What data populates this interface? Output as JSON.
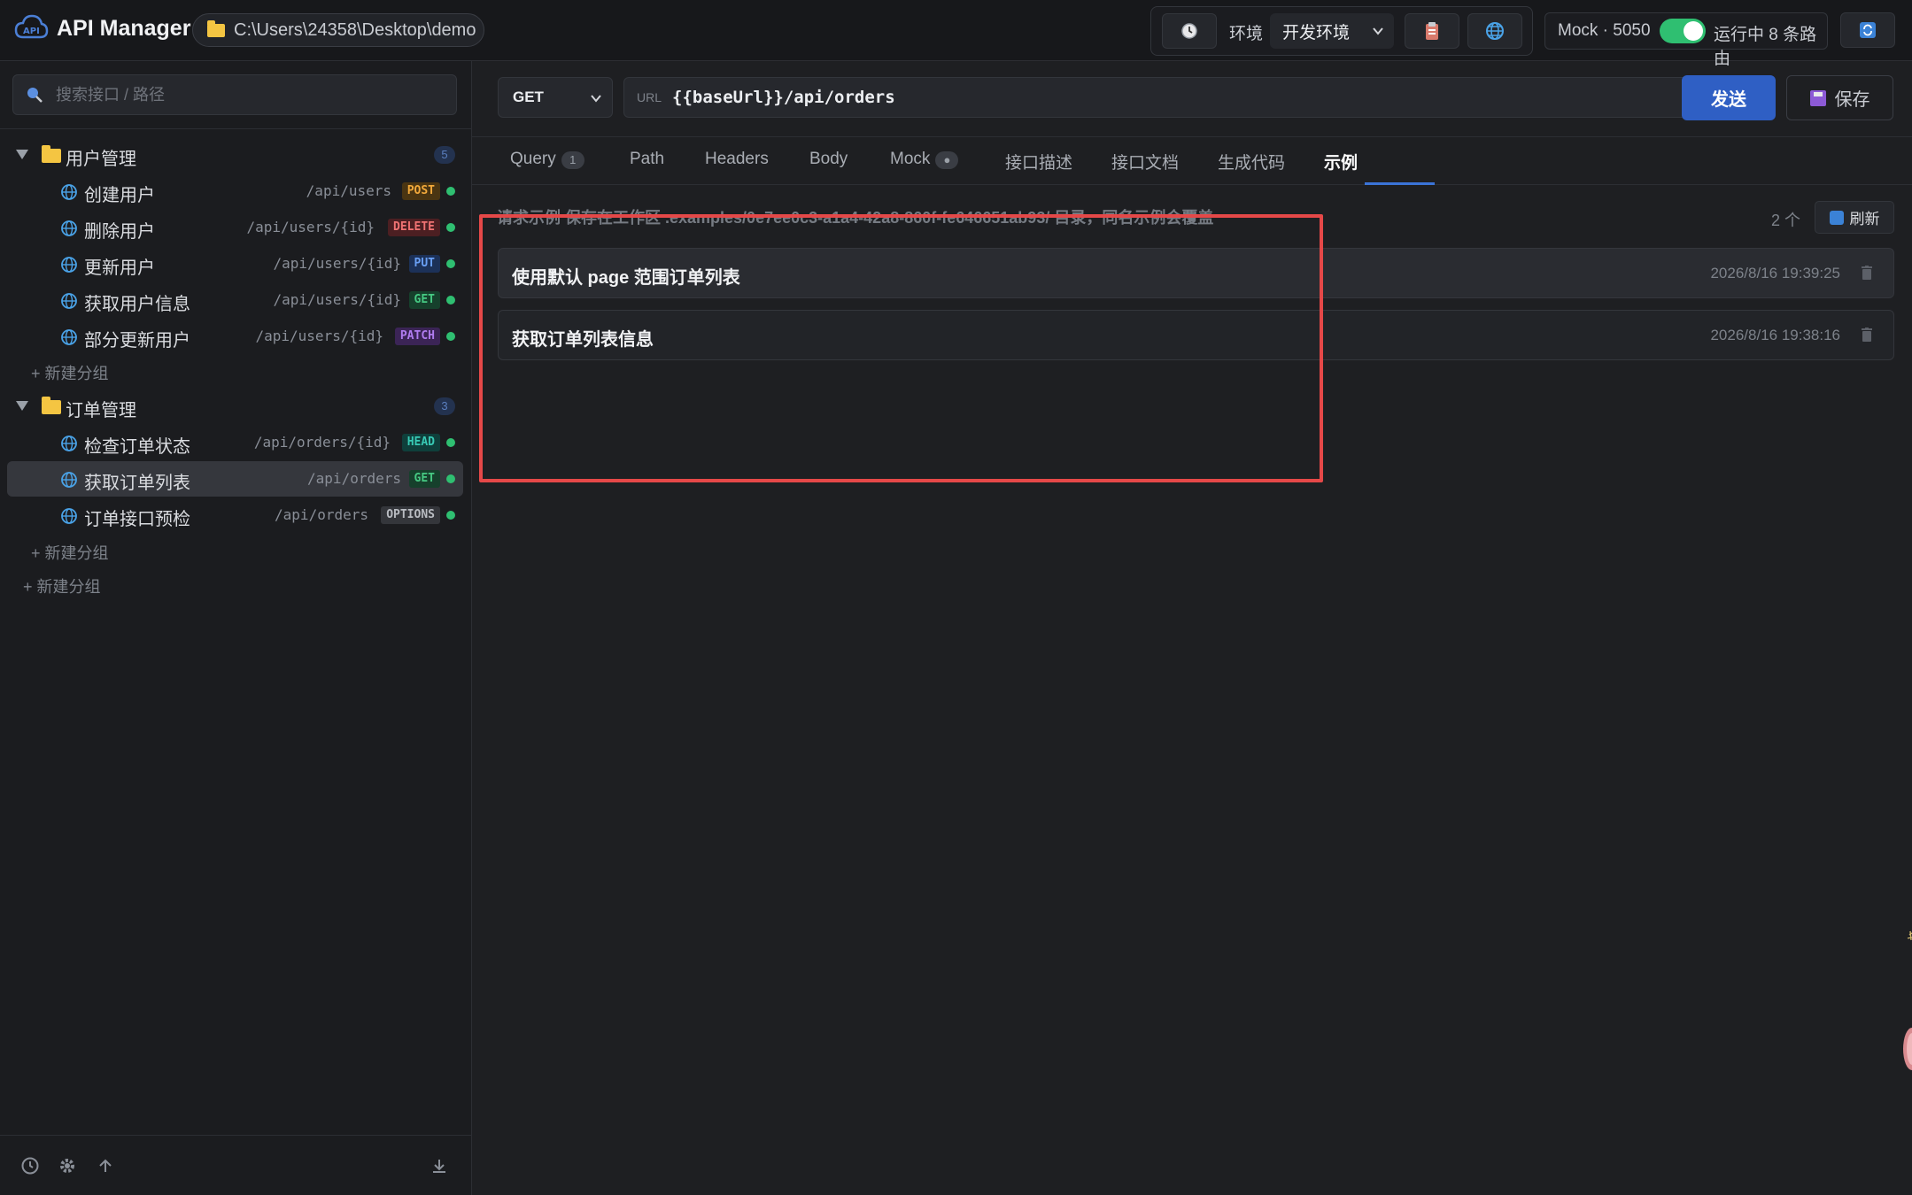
{
  "app": {
    "title": "API Manager",
    "workspace_path": "C:\\Users\\24358\\Desktop\\demo"
  },
  "toolbar": {
    "history_icon": "clock-icon",
    "env_label": "环境",
    "env_value": "开发环境",
    "clipboard_icon": "clipboard-icon",
    "globe_icon": "globe-icon",
    "mock_label": "Mock · 5050",
    "mock_enabled": true,
    "mock_status": "运行中 8 条路由",
    "sync_icon": "sync-icon"
  },
  "sidebar": {
    "search_placeholder": "搜索接口 / 路径",
    "groups": [
      {
        "name": "用户管理",
        "count": "5",
        "endpoints": [
          {
            "name": "创建用户",
            "path": "/api/users",
            "method": "POST"
          },
          {
            "name": "删除用户",
            "path": "/api/users/{id}",
            "method": "DELETE"
          },
          {
            "name": "更新用户",
            "path": "/api/users/{id}",
            "method": "PUT"
          },
          {
            "name": "获取用户信息",
            "path": "/api/users/{id}",
            "method": "GET"
          },
          {
            "name": "部分更新用户",
            "path": "/api/users/{id}",
            "method": "PATCH"
          }
        ],
        "add_subgroup": "新建分组"
      },
      {
        "name": "订单管理",
        "count": "3",
        "endpoints": [
          {
            "name": "检查订单状态",
            "path": "/api/orders/{id}",
            "method": "HEAD"
          },
          {
            "name": "获取订单列表",
            "path": "/api/orders",
            "method": "GET",
            "active": true
          },
          {
            "name": "订单接口预检",
            "path": "/api/orders",
            "method": "OPTIONS"
          }
        ],
        "add_subgroup": "新建分组"
      }
    ],
    "add_group": "新建分组"
  },
  "request": {
    "method": "GET",
    "url_label": "URL",
    "url": "{{baseUrl}}/api/orders",
    "send_label": "发送",
    "save_label": "保存"
  },
  "tabs": [
    {
      "label": "Query",
      "badge": "1"
    },
    {
      "label": "Path"
    },
    {
      "label": "Headers"
    },
    {
      "label": "Body"
    },
    {
      "label": "Mock",
      "badge": "●"
    },
    {
      "label": "接口描述"
    },
    {
      "label": "接口文档"
    },
    {
      "label": "生成代码"
    },
    {
      "label": "示例",
      "active": true
    }
  ],
  "examples": {
    "hint": "请求示例 保存在工作区 .examples/0e7ee0c3-a1a4-42a8-860f-fe646651ab93/ 目录，同名示例会覆盖",
    "count": "2 个",
    "refresh_label": "刷新",
    "items": [
      {
        "title": "使用默认 page 范围订单列表",
        "time": "2026/8/16 19:39:25"
      },
      {
        "title": "获取订单列表信息",
        "time": "2026/8/16 19:38:16"
      }
    ]
  },
  "colors": {
    "accent": "#2f5fc4",
    "highlight": "#e54848",
    "status_ok": "#2fbf71"
  }
}
